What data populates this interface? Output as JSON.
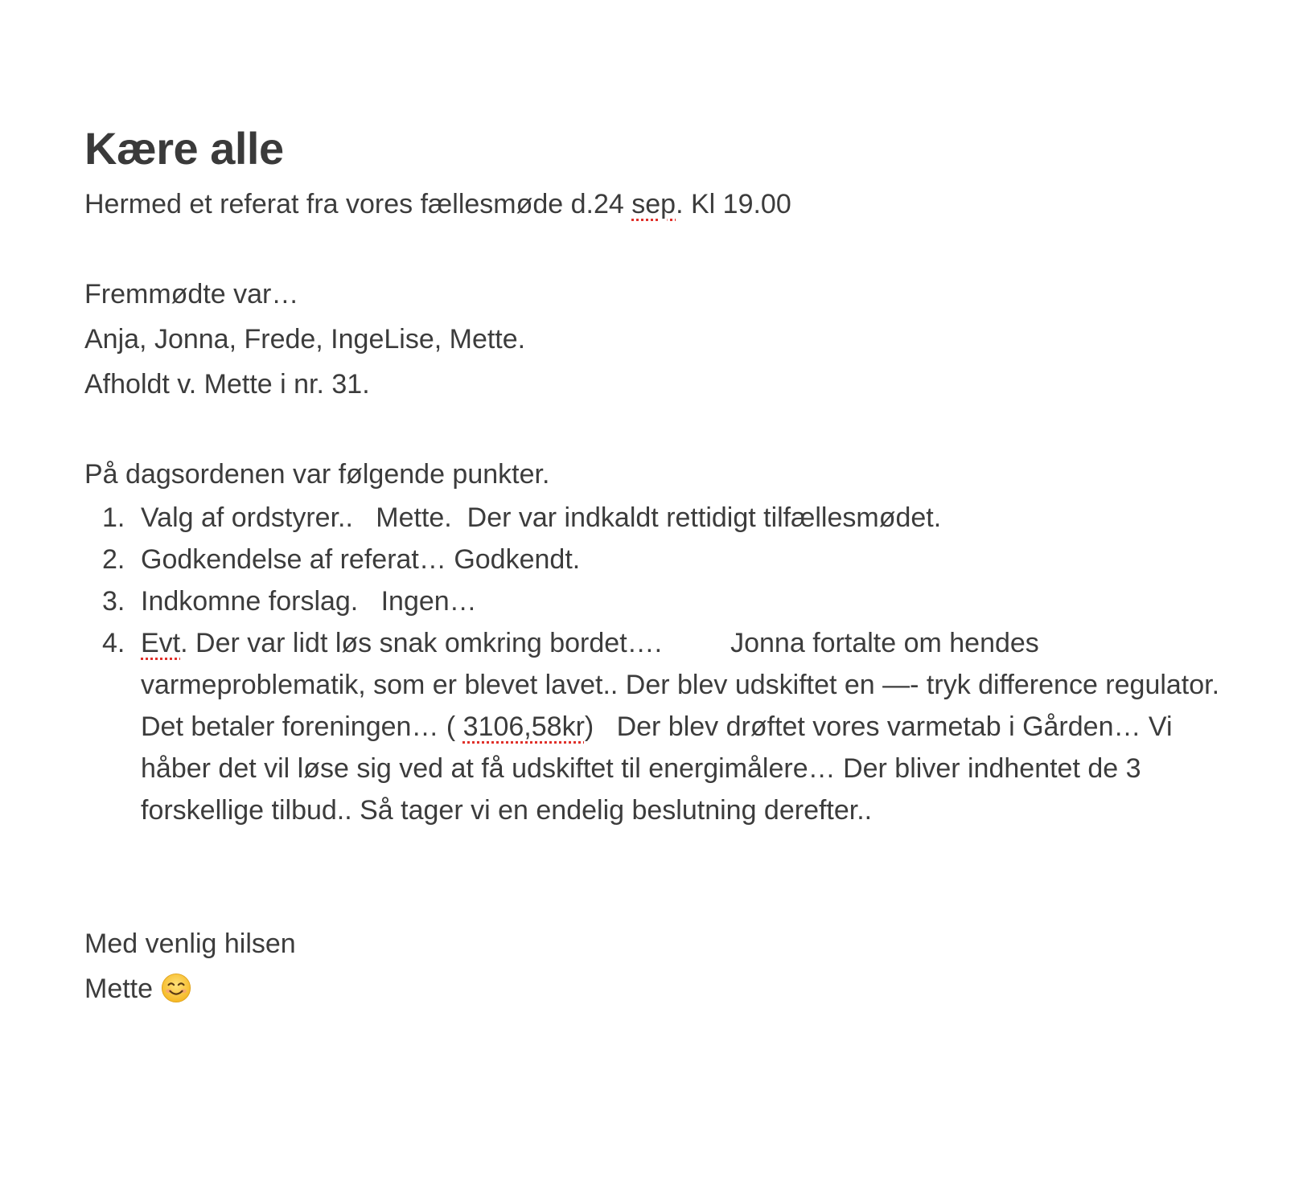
{
  "note": {
    "title": "Kære alle",
    "intro": {
      "before": "Hermed et referat fra vores fællesmøde d.24 ",
      "flagged": "sep",
      "after": ". Kl 19.00"
    },
    "attendees_heading": "Fremmødte var…",
    "attendees": "Anja, Jonna, Frede, IngeLise, Mette.",
    "location": "Afholdt v. Mette i nr. 31.",
    "agenda_heading": "På dagsordenen var følgende punkter.",
    "agenda": [
      {
        "num": "1.",
        "text": "Valg af ordstyrer..   Mette.  Der var indkaldt rettidigt tilfællesmødet."
      },
      {
        "num": "2.",
        "text": "Godkendelse af referat… Godkendt."
      },
      {
        "num": "3.",
        "text": "Indkomne forslag.   Ingen…"
      },
      {
        "num": "4.",
        "flagged_1": "Evt",
        "part_1": ". Der var lidt løs snak omkring bordet….         Jonna fortalte om hendes varmeproblematik, som er blevet lavet.. Der blev udskiftet en —- tryk difference regulator.  Det betaler foreningen… ( ",
        "flagged_2": "3106,58kr",
        "part_2": ")   Der blev drøftet vores varmetab i Gården… Vi håber det vil løse sig ved at få udskiftet til energimålere… Der bliver indhentet de 3 forskellige tilbud.. Så tager vi en endelig beslutning derefter.."
      }
    ],
    "closing": "Med venlig hilsen",
    "signature": "Mette",
    "signature_emoji": "smiling-face-icon",
    "spellcheck_color": "#e0302a",
    "text_color": "#3c3c3c"
  }
}
